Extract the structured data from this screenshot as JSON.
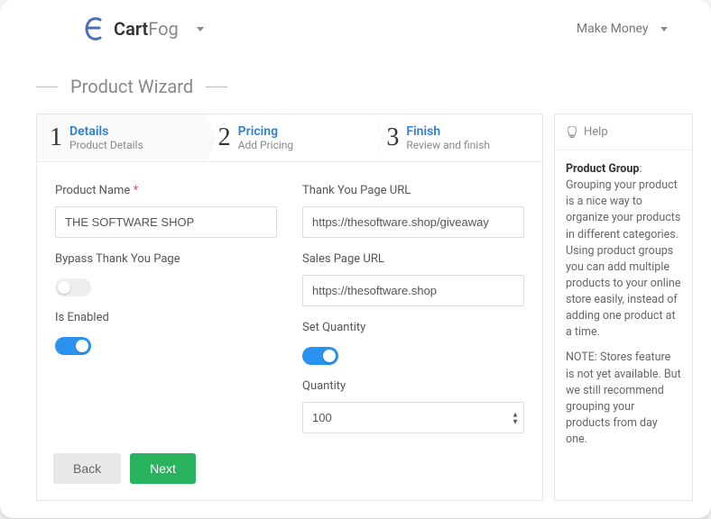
{
  "brand": {
    "bold": "Cart",
    "light": "Fog"
  },
  "nav": {
    "make_money": "Make Money"
  },
  "page_title": "Product Wizard",
  "steps": [
    {
      "num": "1",
      "title": "Details",
      "sub": "Product Details"
    },
    {
      "num": "2",
      "title": "Pricing",
      "sub": "Add Pricing"
    },
    {
      "num": "3",
      "title": "Finish",
      "sub": "Review and finish"
    }
  ],
  "form": {
    "left": {
      "product_name_label": "Product Name",
      "product_name_value": "THE SOFTWARE SHOP",
      "bypass_label": "Bypass Thank You Page",
      "bypass_on": false,
      "enabled_label": "Is Enabled",
      "enabled_on": true
    },
    "right": {
      "thank_you_label": "Thank You Page URL",
      "thank_you_value": "https://thesoftware.shop/giveaway",
      "sales_label": "Sales Page URL",
      "sales_value": "https://thesoftware.shop",
      "set_qty_label": "Set Quantity",
      "set_qty_on": true,
      "qty_label": "Quantity",
      "qty_value": "100"
    }
  },
  "buttons": {
    "back": "Back",
    "next": "Next"
  },
  "help": {
    "title": "Help",
    "heading": "Product Group",
    "body1": ": Grouping your product is a nice way to organize your products in different categories. Using product groups you can add multiple products to your online store easily, instead of adding one product at a time.",
    "body2": "NOTE: Stores feature is not yet available. But we still recommend grouping your products from day one."
  }
}
